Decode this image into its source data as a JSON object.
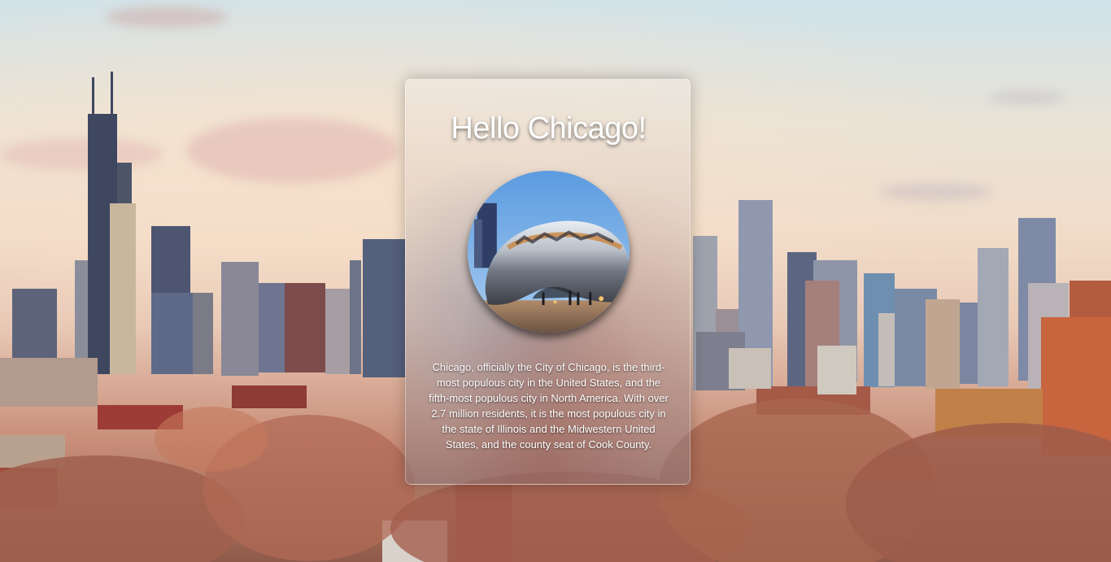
{
  "card": {
    "title": "Hello Chicago!",
    "image_alt": "Cloud Gate sculpture in Chicago",
    "description": "Chicago, officially the City of Chicago, is the third-most populous city in the United States, and the fifth-most populous city in North America. With over 2.7 million residents, it is the most populous city in the state of Illinois and the Midwestern United States, and the county seat of Cook County."
  },
  "background": {
    "subject": "Chicago skyline at sunset"
  }
}
